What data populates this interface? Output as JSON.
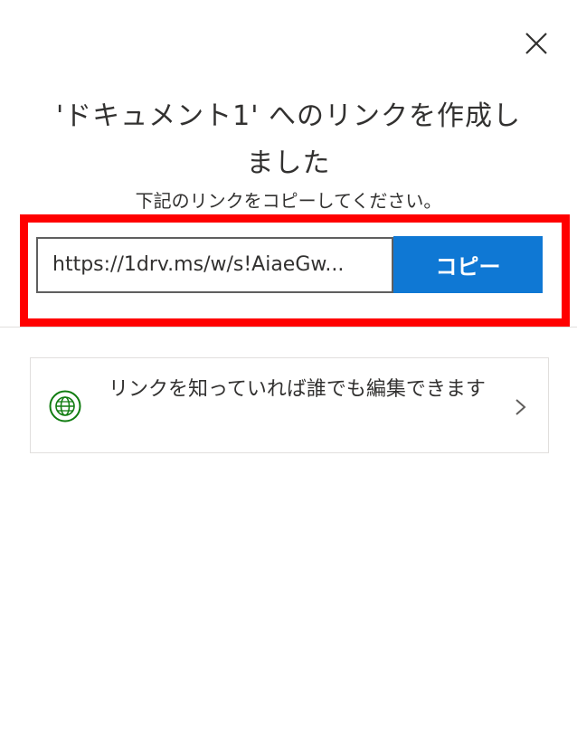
{
  "dialog": {
    "title_line1": "'ドキュメント1' へのリンクを作成し",
    "title_line2": "ました",
    "subtitle": "下記のリンクをコピーしてください。",
    "close_icon": "close-icon"
  },
  "link": {
    "url": "https://1drv.ms/w/s!AiaeGw...",
    "copy_label": "コピー"
  },
  "settings": {
    "text": "リンクを知っていれば誰でも編集できます",
    "icon": "globe-icon",
    "chevron": "chevron-right-icon"
  },
  "colors": {
    "accent": "#0f78d4",
    "highlight": "#ff0000",
    "globe": "#107c10"
  }
}
